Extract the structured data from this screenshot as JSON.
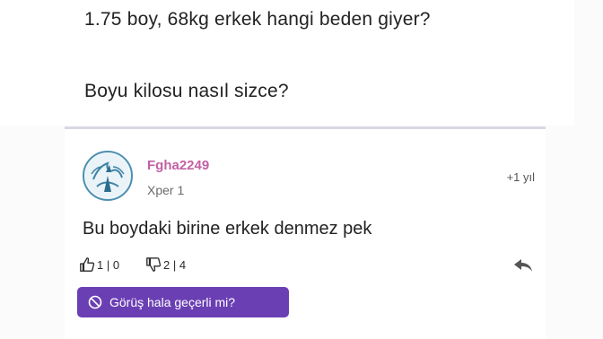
{
  "question": {
    "line1": "1.75 boy, 68kg erkek hangi beden giyer?",
    "line2": "Boyu kilosu nasıl sizce?"
  },
  "answer": {
    "username": "Fgha2249",
    "user_level": "Xper 1",
    "timestamp": "+1 yıl",
    "text": "Bu boydaki birine erkek denmez pek",
    "likes": "1 | 0",
    "dislikes": "2 | 4",
    "opinion_button_label": "Görüş hala geçerli mi?"
  },
  "icons": {
    "like": "thumbs-up-icon",
    "dislike": "thumbs-down-icon",
    "reply": "reply-arrow-icon",
    "opinion": "prohibit-icon"
  },
  "colors": {
    "username": "#c261a5",
    "button": "#6b3fb4",
    "divider": "#d8d8e4"
  }
}
